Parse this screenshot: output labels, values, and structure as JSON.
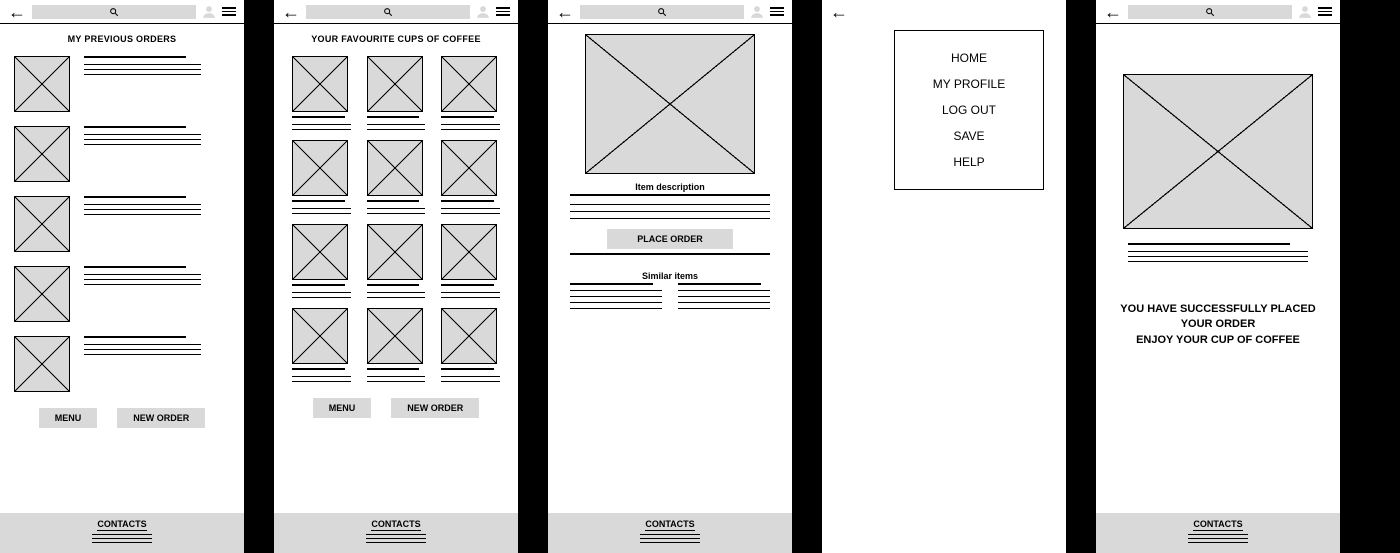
{
  "screens": {
    "s1": {
      "title": "MY PREVIOUS ORDERS"
    },
    "s2": {
      "title": "YOUR FAVOURITE CUPS OF COFFEE"
    },
    "s3": {
      "item_desc_label": "Item description",
      "place_order_label": "PLACE ORDER",
      "similar_label": "Similar items"
    },
    "s4": {
      "menu": [
        "HOME",
        "MY PROFILE",
        "LOG OUT",
        "SAVE",
        "HELP"
      ]
    },
    "s5": {
      "msg_line1": "YOU HAVE SUCCESSFULLY PLACED",
      "msg_line2": "YOUR ORDER",
      "msg_line3": "ENJOY YOUR CUP OF COFFEE"
    }
  },
  "common": {
    "menu_btn": "MENU",
    "neworder_btn": "NEW ORDER",
    "contacts_label": "CONTACTS"
  }
}
